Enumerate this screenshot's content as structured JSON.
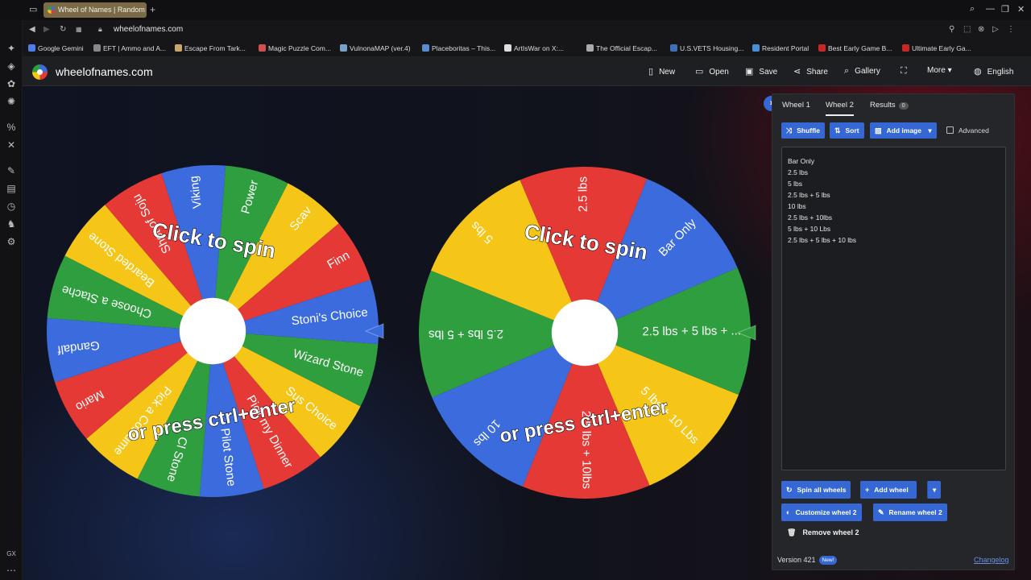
{
  "browser": {
    "tab_title": "Wheel of Names | Random",
    "url": "wheelofnames.com",
    "bookmarks": [
      "Google Gemini",
      "EFT | Ammo and A...",
      "Escape From Tark...",
      "Magic Puzzle Com...",
      "VulnonaMAP (ver.4)",
      "Placeboritas – This...",
      "ArtIsWar on X:...",
      "The Official Escap...",
      "U.S.VETS Housing...",
      "Resident Portal",
      "Best Early Game B...",
      "Ultimate Early Ga..."
    ],
    "bookmark_colors": [
      "#4f7ce8",
      "#888888",
      "#c9a86a",
      "#d05050",
      "#7aa0c8",
      "#5a8ad0",
      "#dddddd",
      "#aaaaaa",
      "#3f6fb5",
      "#4a8fd6",
      "#c62828",
      "#c62828"
    ]
  },
  "header": {
    "site_name": "wheelofnames.com",
    "new_label": "New",
    "open_label": "Open",
    "save_label": "Save",
    "share_label": "Share",
    "gallery_label": "Gallery",
    "more_label": "More",
    "language_label": "English"
  },
  "wheels": [
    {
      "segments": [
        {
          "label": "Viking",
          "color": "#3b6bdc"
        },
        {
          "label": "Power",
          "color": "#2e9e3e"
        },
        {
          "label": "Scav",
          "color": "#f5c518"
        },
        {
          "label": "Finn",
          "color": "#e53935"
        },
        {
          "label": "Stoni's Choice",
          "color": "#3b6bdc"
        },
        {
          "label": "Wizard Stone",
          "color": "#2e9e3e"
        },
        {
          "label": "Sus Choice",
          "color": "#f5c518"
        },
        {
          "label": "Pick my Dinner",
          "color": "#e53935"
        },
        {
          "label": "Pilot Stone",
          "color": "#3b6bdc"
        },
        {
          "label": "Cl Stone",
          "color": "#2e9e3e"
        },
        {
          "label": "Pick a Costume",
          "color": "#f5c518"
        },
        {
          "label": "Mario",
          "color": "#e53935"
        },
        {
          "label": "Gandalf",
          "color": "#3b6bdc"
        },
        {
          "label": "Choose a Stache",
          "color": "#2e9e3e"
        },
        {
          "label": "Bearded Stone",
          "color": "#f5c518"
        },
        {
          "label": "Shot of Soju",
          "color": "#e53935"
        }
      ],
      "spin_line1": "Click to spin",
      "spin_line2": "or press ctrl+enter"
    },
    {
      "segments": [
        {
          "label": "Bar Only",
          "color": "#3b6bdc"
        },
        {
          "label": "2.5 lbs + 5 lbs + ...",
          "color": "#2e9e3e"
        },
        {
          "label": "5 lbs + 10 Lbs",
          "color": "#f5c518"
        },
        {
          "label": "2.5 lbs + 10lbs",
          "color": "#e53935"
        },
        {
          "label": "10 lbs",
          "color": "#3b6bdc"
        },
        {
          "label": "2.5 lbs + 5 lbs",
          "color": "#2e9e3e"
        },
        {
          "label": "5 lbs",
          "color": "#f5c518"
        },
        {
          "label": "2.5 lbs",
          "color": "#e53935"
        }
      ],
      "spin_line1": "Click to spin",
      "spin_line2": "or press ctrl+enter"
    }
  ],
  "panel": {
    "tabs": [
      "Wheel 1",
      "Wheel 2",
      "Results"
    ],
    "results_count": "0",
    "shuffle_label": "Shuffle",
    "sort_label": "Sort",
    "add_image_label": "Add image",
    "advanced_label": "Advanced",
    "entries": [
      "Bar Only",
      "2.5 lbs",
      "5 lbs",
      "2.5 lbs + 5 lbs",
      "10 lbs",
      "2.5 lbs + 10lbs",
      "5 lbs + 10 Lbs",
      "2.5 lbs + 5 lbs + 10 lbs"
    ],
    "spin_all_label": "Spin all wheels",
    "add_wheel_label": "Add wheel",
    "customize_label": "Customize wheel 2",
    "rename_label": "Rename wheel 2",
    "remove_label": "Remove wheel 2",
    "version": "Version 421",
    "new_badge": "New!",
    "changelog": "Changelog"
  }
}
